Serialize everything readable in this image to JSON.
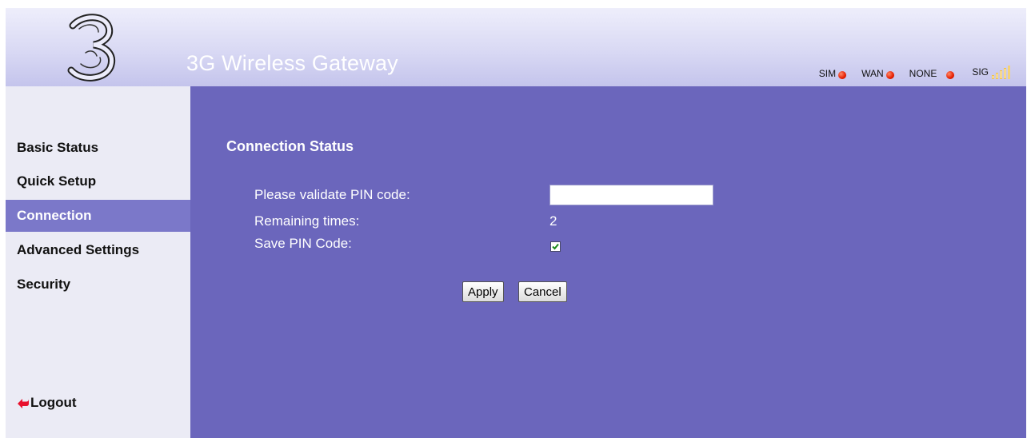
{
  "header": {
    "title": "3G Wireless Gateway",
    "indicators": [
      {
        "label": "SIM",
        "icon": "red-status-dot-icon"
      },
      {
        "label": "WAN",
        "icon": "red-status-dot-icon"
      },
      {
        "label": "NONE",
        "icon": "red-status-dot-icon"
      }
    ],
    "signal": {
      "label": "SIG",
      "icon": "signal-strength-icon",
      "level": 4,
      "max": 5
    }
  },
  "sidebar": {
    "items": [
      {
        "label": "Basic Status"
      },
      {
        "label": "Quick Setup"
      },
      {
        "label": "Connection",
        "active": true
      },
      {
        "label": "Advanced Settings"
      },
      {
        "label": "Security"
      }
    ],
    "logout_label": "Logout"
  },
  "main": {
    "section_title": "Connection Status",
    "pin_label": "Please validate PIN code:",
    "pin_value": "",
    "remaining_label": "Remaining times:",
    "remaining_value": "2",
    "save_pin_label": "Save PIN Code:",
    "save_pin_checked": true,
    "apply_label": "Apply",
    "cancel_label": "Cancel"
  },
  "colors": {
    "main_bg": "#6b66bc",
    "active_nav": "#7b78c9",
    "sidebar_bg": "#ebebf5",
    "status_red": "#e61d00",
    "signal_on": "#ffffff",
    "signal_off": "#f3d27a"
  }
}
